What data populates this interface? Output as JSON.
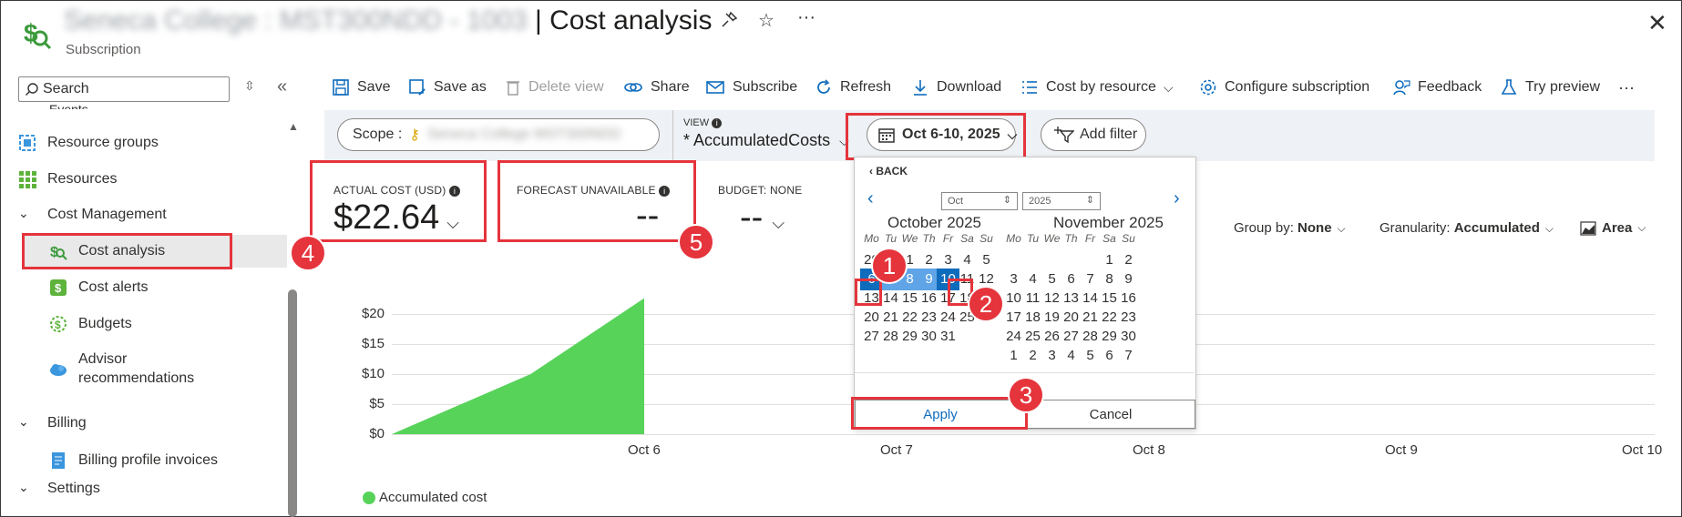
{
  "header": {
    "title_blurred": "Seneca College : MST300NDD - 1003",
    "title": "| Cost analysis",
    "subtitle": "Subscription"
  },
  "sidebar": {
    "search_placeholder": "Search",
    "items": [
      {
        "label": "Events"
      },
      {
        "label": "Resource groups"
      },
      {
        "label": "Resources"
      },
      {
        "label": "Cost Management"
      },
      {
        "label": "Cost analysis"
      },
      {
        "label": "Cost alerts"
      },
      {
        "label": "Budgets"
      },
      {
        "label": "Advisor recommendations"
      },
      {
        "label": "Billing"
      },
      {
        "label": "Billing profile invoices"
      },
      {
        "label": "Settings"
      }
    ]
  },
  "toolbar": {
    "save": "Save",
    "save_as": "Save as",
    "delete_view": "Delete view",
    "share": "Share",
    "subscribe": "Subscribe",
    "refresh": "Refresh",
    "download": "Download",
    "cost_by_resource": "Cost by resource",
    "configure": "Configure subscription",
    "feedback": "Feedback",
    "try_preview": "Try preview",
    "more": "···"
  },
  "filters": {
    "scope_label": "Scope :",
    "scope_value_blurred": "Seneca College MST300NDD",
    "view_label": "VIEW",
    "view_value": "* AccumulatedCosts",
    "date_range": "Oct 6-10, 2025",
    "add_filter": "Add filter"
  },
  "kpis": {
    "actual_label": "ACTUAL COST (USD)",
    "actual_value": "$22.64",
    "forecast_label": "FORECAST UNAVAILABLE",
    "forecast_value": "--",
    "budget_label": "BUDGET: NONE",
    "budget_value": "--"
  },
  "controls": {
    "group_by_label": "Group by:",
    "group_by_value": "None",
    "granularity_label": "Granularity:",
    "granularity_value": "Accumulated",
    "chart_type": "Area"
  },
  "calendar": {
    "back": "BACK",
    "month_select": "Oct",
    "year_select": "2025",
    "left_title": "October 2025",
    "right_title": "November 2025",
    "dow": [
      "Mo",
      "Tu",
      "We",
      "Th",
      "Fr",
      "Sa",
      "Su"
    ],
    "left_weeks": [
      [
        "29",
        "30",
        "1",
        "2",
        "3",
        "4",
        "5"
      ],
      [
        "6",
        "7",
        "8",
        "9",
        "10",
        "11",
        "12"
      ],
      [
        "13",
        "14",
        "15",
        "16",
        "17",
        "18",
        "19"
      ],
      [
        "20",
        "21",
        "22",
        "23",
        "24",
        "25",
        "26"
      ],
      [
        "27",
        "28",
        "29",
        "30",
        "31",
        "",
        ""
      ]
    ],
    "right_weeks": [
      [
        "",
        "",
        "",
        "",
        "",
        "1",
        "2"
      ],
      [
        "3",
        "4",
        "5",
        "6",
        "7",
        "8",
        "9"
      ],
      [
        "10",
        "11",
        "12",
        "13",
        "14",
        "15",
        "16"
      ],
      [
        "17",
        "18",
        "19",
        "20",
        "21",
        "22",
        "23"
      ],
      [
        "24",
        "25",
        "26",
        "27",
        "28",
        "29",
        "30"
      ],
      [
        "1",
        "2",
        "3",
        "4",
        "5",
        "6",
        "7"
      ]
    ],
    "apply": "Apply",
    "cancel": "Cancel"
  },
  "annotations": [
    "1",
    "2",
    "3",
    "4",
    "5"
  ],
  "chart_data": {
    "type": "area",
    "x": [
      "Oct 6",
      "Oct 7",
      "Oct 8",
      "Oct 9",
      "Oct 10"
    ],
    "series": [
      {
        "name": "Accumulated cost",
        "color": "#57d35a",
        "points": [
          [
            0,
            0
          ],
          [
            0.55,
            10
          ],
          [
            1,
            22.64
          ]
        ]
      }
    ],
    "yticks": [
      "$20",
      "$15",
      "$10",
      "$5",
      "$0"
    ],
    "ylim": [
      0,
      22.64
    ],
    "grid": true,
    "legend": "bottom-left"
  },
  "colors": {
    "accent": "#0f6cbd",
    "highlight": "#5fa4e6",
    "annotation": "#e5343c",
    "area": "#57d35a"
  }
}
